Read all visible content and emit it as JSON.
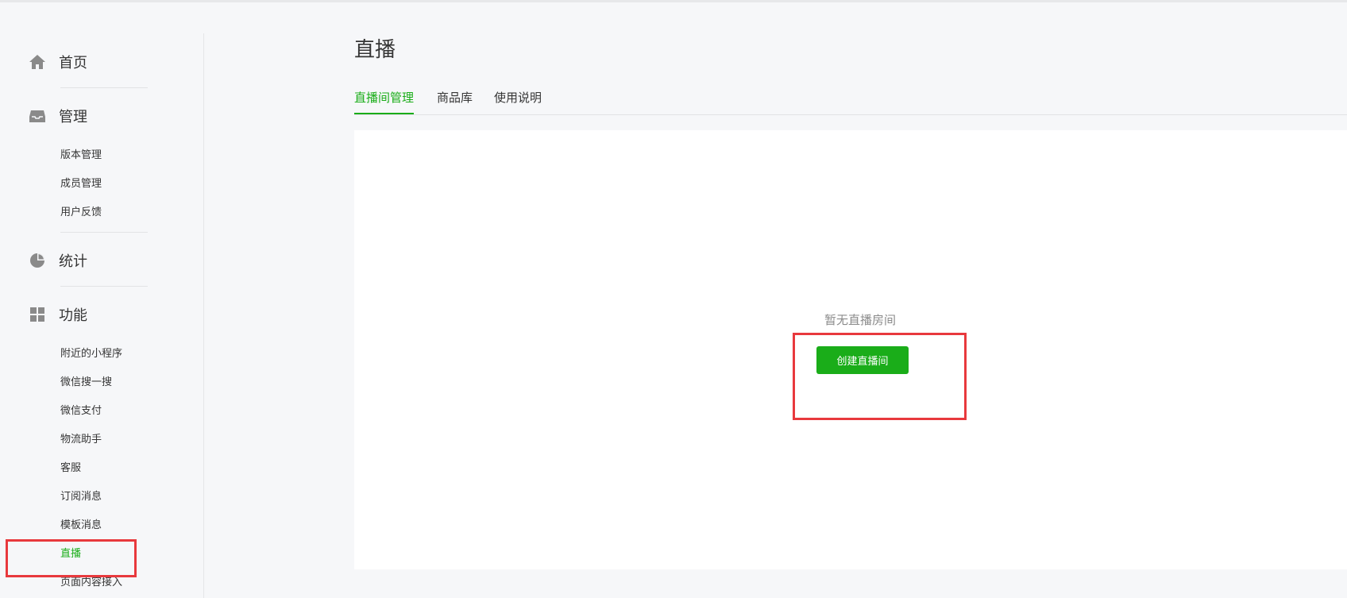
{
  "sidebar": {
    "sections": [
      {
        "label": "首页",
        "icon": "home-icon"
      },
      {
        "label": "管理",
        "icon": "inbox-icon",
        "items": [
          "版本管理",
          "成员管理",
          "用户反馈"
        ]
      },
      {
        "label": "统计",
        "icon": "pie-chart-icon"
      },
      {
        "label": "功能",
        "icon": "grid-icon",
        "items": [
          "附近的小程序",
          "微信搜一搜",
          "微信支付",
          "物流助手",
          "客服",
          "订阅消息",
          "模板消息",
          "直播",
          "页面内容接入"
        ]
      }
    ],
    "active_item": "直播"
  },
  "main": {
    "title": "直播",
    "tabs": [
      {
        "label": "直播间管理",
        "active": true
      },
      {
        "label": "商品库",
        "active": false
      },
      {
        "label": "使用说明",
        "active": false
      }
    ],
    "empty_text": "暂无直播房间",
    "create_button": "创建直播间"
  },
  "colors": {
    "accent": "#1aad19",
    "highlight": "#e8393d",
    "text": "#353535",
    "muted": "#8b8b8b",
    "background": "#f6f7f9"
  }
}
